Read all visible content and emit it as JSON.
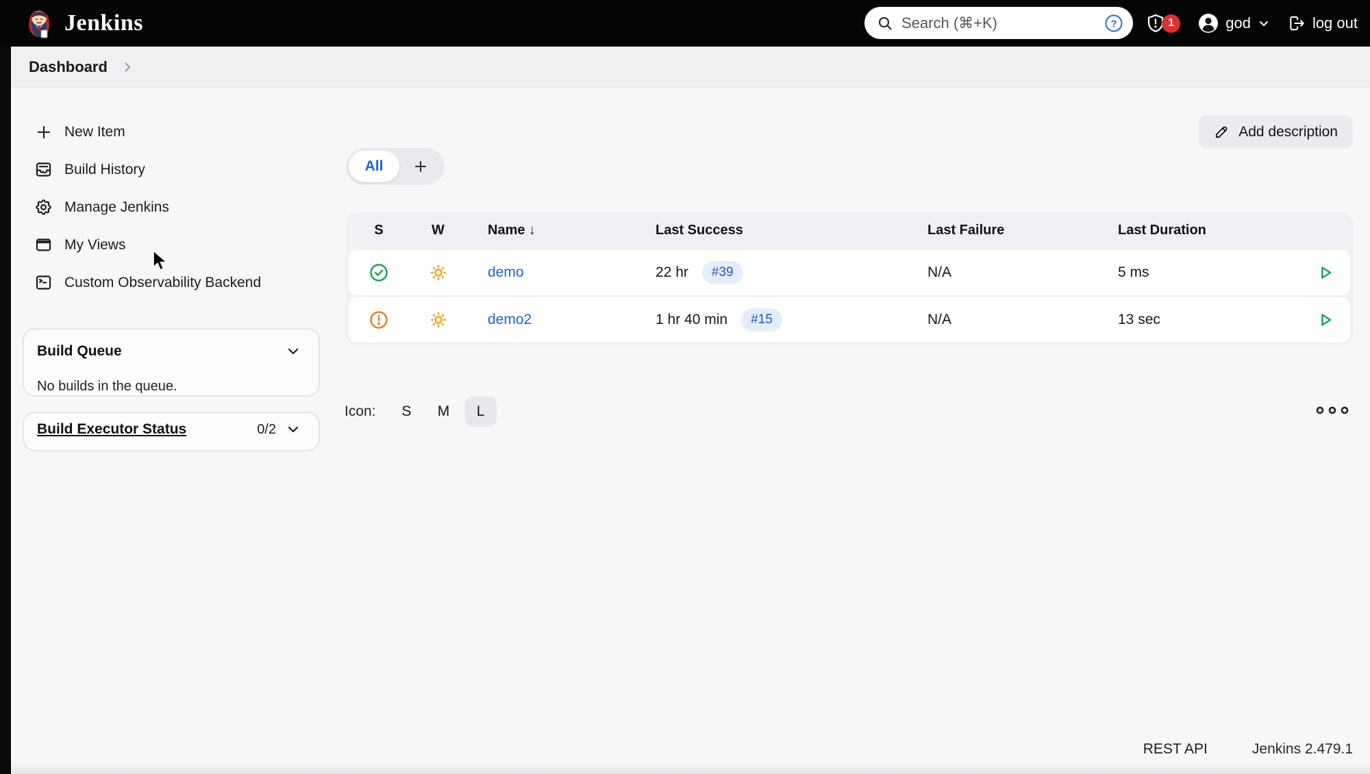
{
  "colors": {
    "accent-blue": "#2162d0",
    "success-green": "#14a050",
    "warning-orange": "#e07c1c",
    "sun-yellow": "#f5a01d",
    "badge-red": "#dc2f32"
  },
  "topbar": {
    "brand": "Jenkins",
    "search": {
      "placeholder": "Search (⌘+K)"
    },
    "notification_count": "1",
    "user": "god",
    "logout_label": "log out"
  },
  "breadcrumb": {
    "items": [
      {
        "label": "Dashboard"
      }
    ]
  },
  "sidebar": {
    "items": [
      {
        "label": "New Item"
      },
      {
        "label": "Build History"
      },
      {
        "label": "Manage Jenkins"
      },
      {
        "label": "My Views"
      },
      {
        "label": "Custom Observability Backend"
      }
    ],
    "build_queue": {
      "title": "Build Queue",
      "empty_text": "No builds in the queue."
    },
    "executor_status": {
      "title": "Build Executor Status",
      "count": "0/2"
    }
  },
  "main": {
    "add_description_label": "Add description",
    "tabs": [
      {
        "label": "All",
        "active": true
      }
    ],
    "table": {
      "columns": [
        "S",
        "W",
        "Name",
        "Last Success",
        "Last Failure",
        "Last Duration"
      ],
      "sort_arrow": "↓",
      "rows": [
        {
          "status": "success",
          "weather": "sunny",
          "name": "demo",
          "last_success": "22 hr",
          "last_success_build": "#39",
          "last_failure": "N/A",
          "last_duration": "5 ms"
        },
        {
          "status": "unstable",
          "weather": "sunny",
          "name": "demo2",
          "last_success": "1 hr 40 min",
          "last_success_build": "#15",
          "last_failure": "N/A",
          "last_duration": "13 sec"
        }
      ]
    },
    "icon_size": {
      "label": "Icon:",
      "options": [
        "S",
        "M",
        "L"
      ],
      "selected": "L"
    }
  },
  "footer": {
    "rest_api_label": "REST API",
    "version": "Jenkins 2.479.1"
  }
}
